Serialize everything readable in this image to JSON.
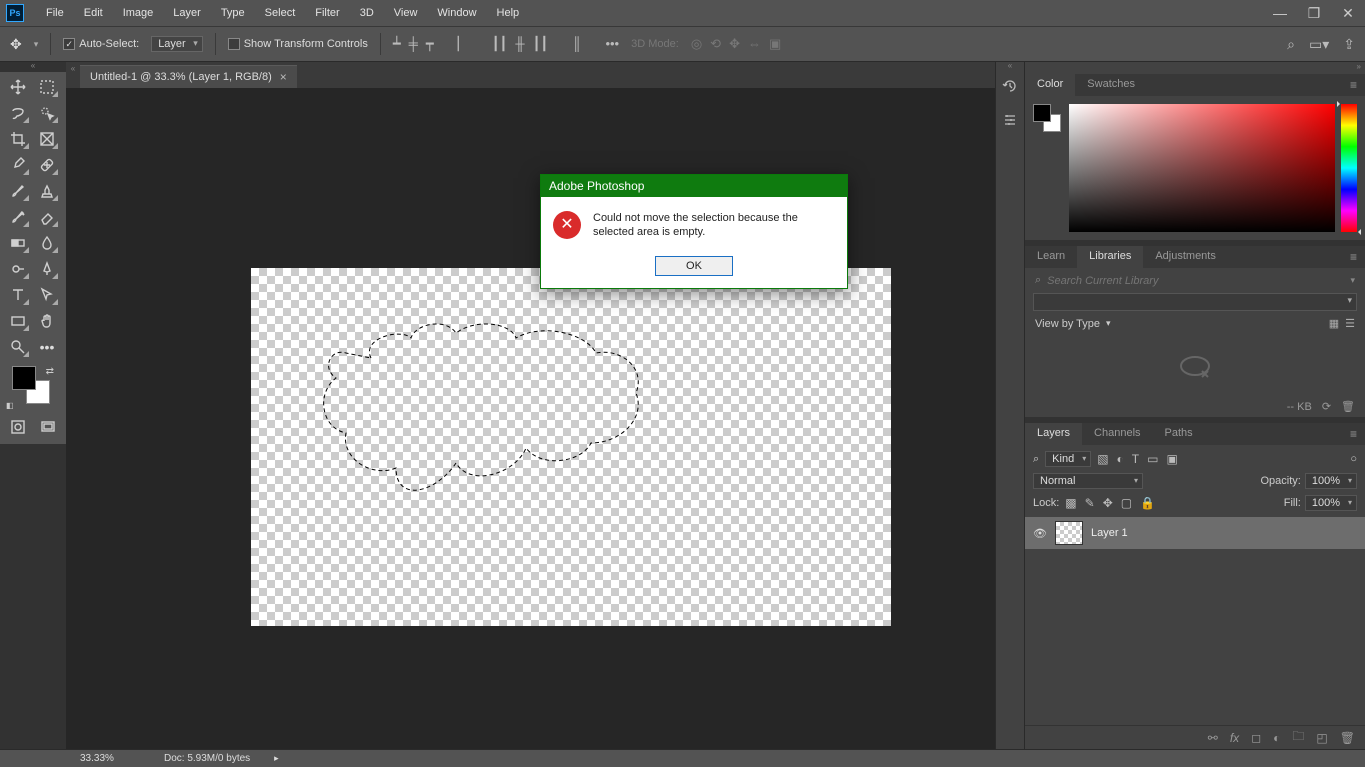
{
  "menubar": {
    "items": [
      "File",
      "Edit",
      "Image",
      "Layer",
      "Type",
      "Select",
      "Filter",
      "3D",
      "View",
      "Window",
      "Help"
    ]
  },
  "optionsbar": {
    "auto_select_label": "Auto-Select:",
    "auto_select_target": "Layer",
    "show_transform_label": "Show Transform Controls",
    "mode3d_label": "3D Mode:"
  },
  "document": {
    "tab_title": "Untitled-1 @ 33.3% (Layer 1, RGB/8)"
  },
  "panels": {
    "color_tabs": [
      "Color",
      "Swatches"
    ],
    "lib_tabs": [
      "Learn",
      "Libraries",
      "Adjustments"
    ],
    "lib_search_placeholder": "Search Current Library",
    "lib_view_label": "View by Type",
    "lib_size": "-- KB",
    "layer_tabs": [
      "Layers",
      "Channels",
      "Paths"
    ],
    "layer_filter": "Kind",
    "blend_mode": "Normal",
    "opacity_label": "Opacity:",
    "opacity_value": "100%",
    "lock_label": "Lock:",
    "fill_label": "Fill:",
    "fill_value": "100%",
    "layers": [
      {
        "name": "Layer 1"
      }
    ]
  },
  "statusbar": {
    "zoom": "33.33%",
    "doc_info": "Doc: 5.93M/0 bytes"
  },
  "dialog": {
    "title": "Adobe Photoshop",
    "message": "Could not move the selection because the selected area is empty.",
    "ok_label": "OK"
  }
}
